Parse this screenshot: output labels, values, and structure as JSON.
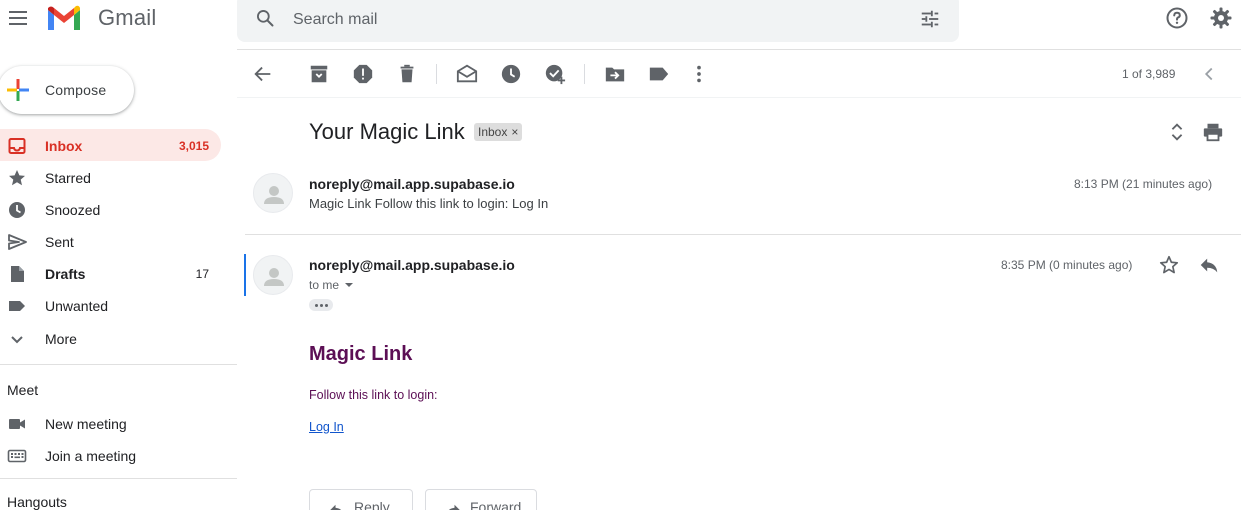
{
  "header": {
    "app_name": "Gmail",
    "search_placeholder": "Search mail"
  },
  "sidebar": {
    "compose_label": "Compose",
    "items": [
      {
        "label": "Inbox",
        "count": "3,015"
      },
      {
        "label": "Starred",
        "count": ""
      },
      {
        "label": "Snoozed",
        "count": ""
      },
      {
        "label": "Sent",
        "count": ""
      },
      {
        "label": "Drafts",
        "count": "17"
      },
      {
        "label": "Unwanted",
        "count": ""
      },
      {
        "label": "More",
        "count": ""
      }
    ],
    "meet": {
      "title": "Meet",
      "new_meeting": "New meeting",
      "join_meeting": "Join a meeting"
    },
    "hangouts_title": "Hangouts"
  },
  "toolbar": {
    "pager": "1 of 3,989"
  },
  "thread": {
    "subject": "Your Magic Link",
    "label_chip": "Inbox",
    "chip_close": "×",
    "messages": [
      {
        "sender": "noreply@mail.app.supabase.io",
        "snippet": "Magic Link Follow this link to login: Log In",
        "time": "8:13 PM (21 minutes ago)"
      },
      {
        "sender": "noreply@mail.app.supabase.io",
        "recipient": "to me",
        "time": "8:35 PM (0 minutes ago)",
        "body_title": "Magic Link",
        "body_text": "Follow this link to login:",
        "body_link": "Log In"
      }
    ],
    "reply_label": "Reply",
    "forward_label": "Forward"
  },
  "colors": {
    "accent_red": "#d93025",
    "active_bg": "#fce8e6",
    "body_text": "#5c0f55",
    "link": "#1155cc",
    "focus": "#1a73e8"
  }
}
